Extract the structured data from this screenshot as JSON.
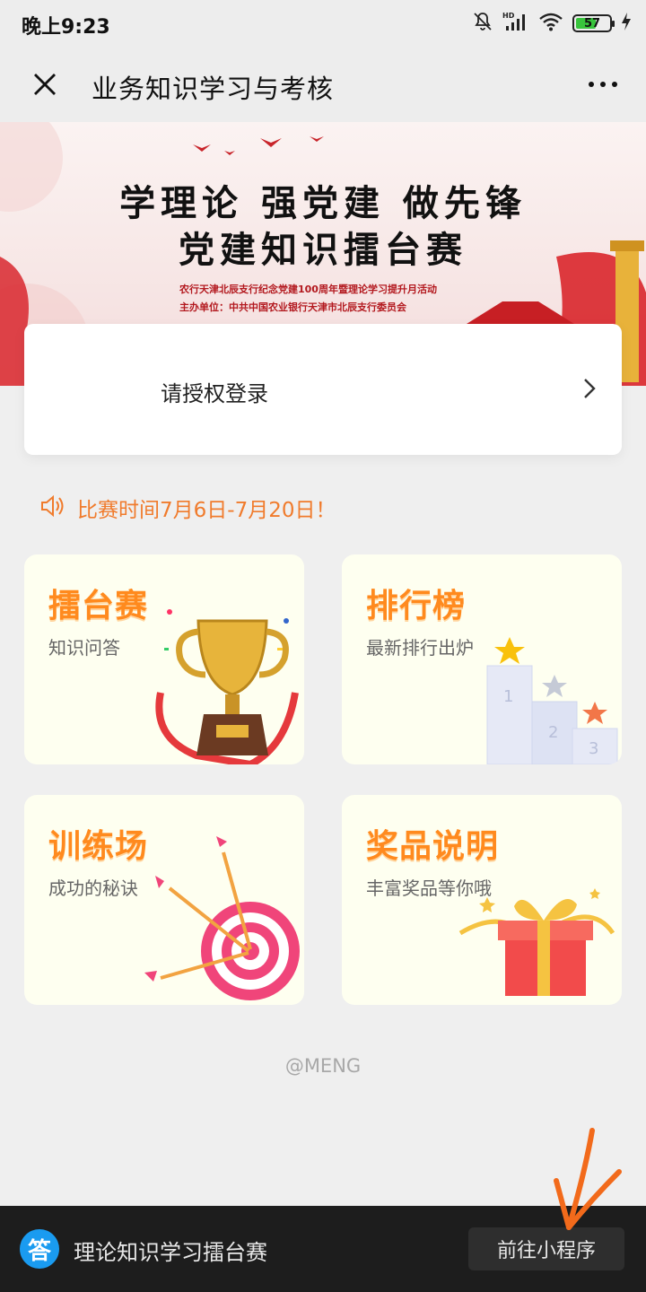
{
  "status_bar": {
    "time": "晚上9:23",
    "battery_level": "57",
    "icons": [
      "mute-icon",
      "hd-signal-icon",
      "wifi-icon",
      "battery-icon",
      "charging-icon"
    ]
  },
  "nav": {
    "title": "业务知识学习与考核",
    "close_icon": "close-icon",
    "more_icon": "more-icon"
  },
  "banner": {
    "line1": "学理论 强党建 做先锋",
    "line2": "党建知识擂台赛",
    "sub1": "农行天津北辰支行纪念党建100周年暨理论学习提升月活动",
    "sub2": "主办单位：中共中国农业银行天津市北辰支行委员会"
  },
  "login": {
    "label": "请授权登录"
  },
  "notice": {
    "text": "比赛时间7月6日-7月20日！",
    "color": "#f07b2c"
  },
  "cards": [
    {
      "title": "擂台赛",
      "subtitle": "知识问答"
    },
    {
      "title": "排行榜",
      "subtitle": "最新排行出炉"
    },
    {
      "title": "训练场",
      "subtitle": "成功的秘诀"
    },
    {
      "title": "奖品说明",
      "subtitle": "丰富奖品等你哦"
    }
  ],
  "watermark": "@MENG",
  "bottom_bar": {
    "badge": "答",
    "title": "理论知识学习擂台赛",
    "button": "前往小程序"
  },
  "colors": {
    "card_title": "#ff8a1e",
    "card_bg": "#fefff0",
    "badge_blue": "#1a9bf0",
    "annotation": "#f26a1b"
  }
}
